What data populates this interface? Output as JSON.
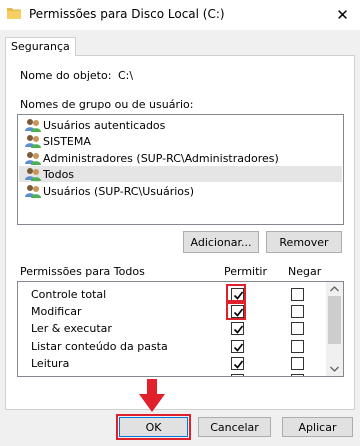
{
  "window": {
    "title": "Permissões para Disco Local (C:)",
    "close_glyph": "✕"
  },
  "tabs": [
    {
      "label": "Segurança"
    }
  ],
  "object": {
    "label": "Nome do objeto:",
    "value": "C:\\"
  },
  "groups": {
    "label": "Nomes de grupo ou de usuário:",
    "items": [
      {
        "label": "Usuários autenticados",
        "icon": "users-icon"
      },
      {
        "label": "SISTEMA",
        "icon": "users-icon"
      },
      {
        "label": "Administradores (SUP-RC\\Administradores)",
        "icon": "users-icon"
      },
      {
        "label": "Todos",
        "icon": "users-icon",
        "selected": true
      },
      {
        "label": "Usuários (SUP-RC\\Usuários)",
        "icon": "users-icon"
      }
    ]
  },
  "buttons": {
    "add": "Adicionar...",
    "remove": "Remover",
    "ok": "OK",
    "cancel": "Cancelar",
    "apply": "Aplicar"
  },
  "permissions": {
    "header": "Permissões para Todos",
    "allow_header": "Permitir",
    "deny_header": "Negar",
    "rows": [
      {
        "name": "Controle total",
        "allow": true,
        "deny": false,
        "highlighted": true
      },
      {
        "name": "Modificar",
        "allow": true,
        "deny": false,
        "highlighted": true
      },
      {
        "name": "Ler & executar",
        "allow": true,
        "deny": false
      },
      {
        "name": "Listar conteúdo da pasta",
        "allow": true,
        "deny": false
      },
      {
        "name": "Leitura",
        "allow": true,
        "deny": false
      }
    ]
  },
  "colors": {
    "accent": "#0078d7",
    "annotation": "#e0202a"
  }
}
